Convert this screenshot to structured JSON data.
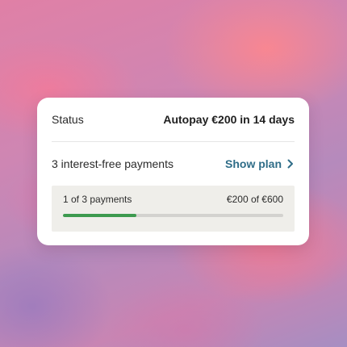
{
  "card": {
    "status_label": "Status",
    "status_value": "Autopay €200 in 14 days",
    "plan_label": "3 interest-free payments",
    "show_plan_label": "Show plan",
    "show_plan_icon": "chevron-right-icon",
    "progress": {
      "count_text": "1 of 3 payments",
      "amount_text": "€200 of €600",
      "paid_fraction": 0.333
    }
  },
  "colors": {
    "accent_link": "#2f6d88",
    "progress_fill": "#3d9a4f",
    "progress_track": "#d3d2cf",
    "panel_background": "#efeeea"
  }
}
